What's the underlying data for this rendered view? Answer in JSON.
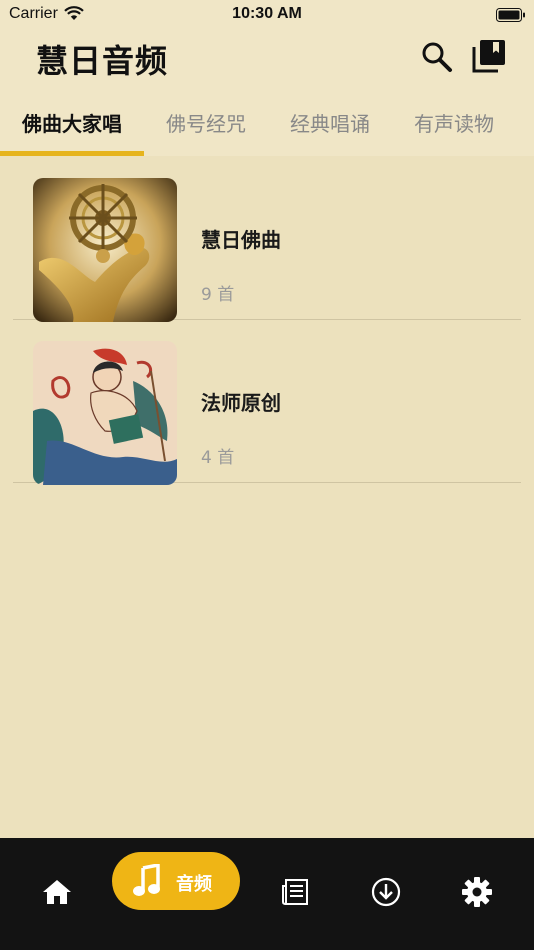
{
  "status_bar": {
    "carrier": "Carrier",
    "time": "10:30 AM"
  },
  "header": {
    "title": "慧日音频"
  },
  "tabs": [
    {
      "label": "佛曲大家唱",
      "active": true
    },
    {
      "label": "佛号经咒",
      "active": false
    },
    {
      "label": "经典唱诵",
      "active": false
    },
    {
      "label": "有声读物",
      "active": false
    }
  ],
  "albums": [
    {
      "title": "慧日佛曲",
      "count": "9 首"
    },
    {
      "title": "法师原创",
      "count": "4 首"
    }
  ],
  "bottom_nav": {
    "items": [
      "home-icon",
      "music-note-icon",
      "news-icon",
      "download-icon",
      "gear-icon"
    ],
    "active_label": "音频"
  },
  "colors": {
    "accent": "#efb515",
    "background": "#ece1bd",
    "header": "#f0e6c6",
    "tabbar": "#131313"
  }
}
